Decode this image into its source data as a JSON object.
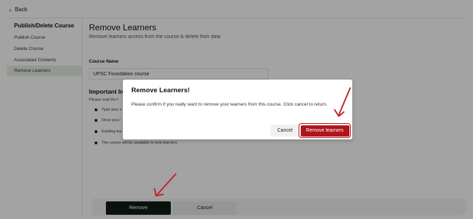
{
  "topbar": {
    "back_label": "Back"
  },
  "sidebar": {
    "title": "Publish/Delete Course",
    "items": [
      {
        "label": "Publish Course"
      },
      {
        "label": "Delete Course"
      },
      {
        "label": "Associated Contents"
      },
      {
        "label": "Remove Learners",
        "active": true
      }
    ]
  },
  "main": {
    "title": "Remove Learners",
    "subtitle": "Remove learners access from the course & delete their data",
    "course_name_label": "Course Name",
    "course_name_value": "UPSC Foundation course",
    "info_title": "Important Int",
    "info_intro": "Please read the f",
    "bullets": [
      "Type your c",
      "Once you r",
      "Existing lea",
      "The course will be available to new learners"
    ]
  },
  "footer": {
    "remove_label": "Remove",
    "cancel_label": "Cancel"
  },
  "modal": {
    "title": "Remove Learners!",
    "message": "Please confirm if you really want to remove your learners from this course. Click cancel to return.",
    "cancel_label": "Cancel",
    "confirm_label": "Remove learners"
  },
  "colors": {
    "accent_dark": "#0f1f12",
    "danger": "#b0151c",
    "sidebar_active": "#e6efe2",
    "annotation_arrow": "#c0262c"
  },
  "icons": {
    "back": "chevron-left-icon",
    "annotation": "arrow-icon"
  }
}
